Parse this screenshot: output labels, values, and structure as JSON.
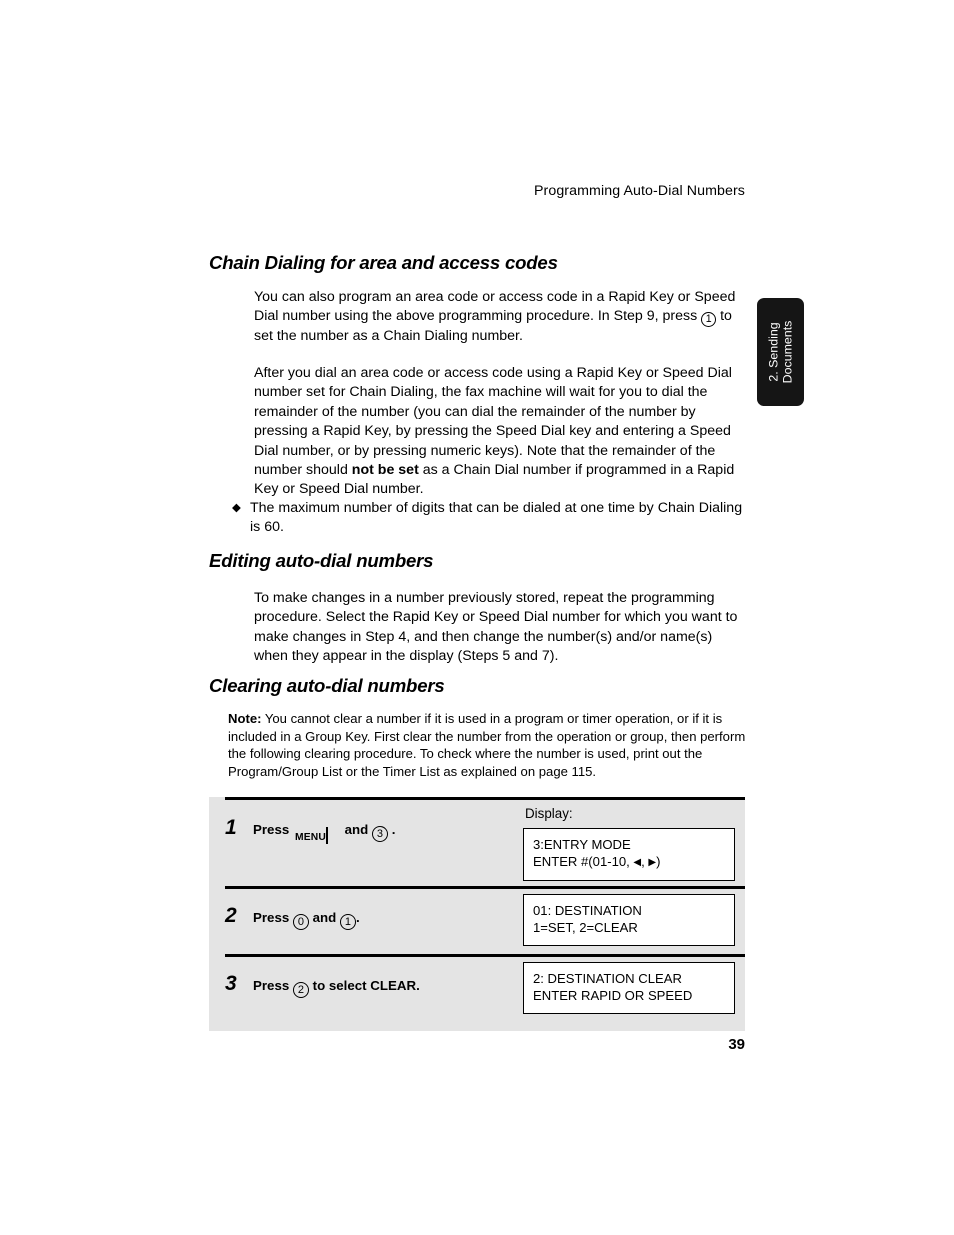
{
  "header": {
    "running_title": "Programming Auto-Dial Numbers"
  },
  "side_tab": {
    "line1": "2. Sending",
    "line2": "Documents",
    "bg_color": "#151515",
    "text_color": "#ffffff"
  },
  "sections": [
    {
      "heading": "Chain Dialing for area and access codes",
      "paragraphs": [
        {
          "pre": "You can also program an area code or access code in a Rapid Key or Speed Dial number using the above programming procedure. In Step 9, press ",
          "key": "1",
          "post": " to set the number as a Chain Dialing number."
        },
        {
          "pre": "After you dial an area code or access code using a Rapid Key or Speed Dial number set for Chain Dialing, the fax machine will wait for you to dial the remainder of the number (you can dial the remainder of the number by pressing a Rapid Key, by pressing the Speed Dial key and entering a Speed Dial number, or by pressing numeric keys). Note that the remainder of the number should ",
          "bold": "not be set",
          "post": " as a Chain Dial number if programmed in a Rapid Key or Speed Dial number."
        }
      ],
      "bullet": {
        "marker": "diamond-bullet",
        "text": "The maximum number of digits that can be dialed at one time by Chain Dialing is 60."
      }
    },
    {
      "heading": "Editing auto-dial numbers",
      "paragraph": "To make changes in a number previously stored, repeat the programming procedure. Select the Rapid Key or Speed Dial number for which you want to make changes in Step 4, and then change the number(s) and/or name(s) when they appear in the display (Steps 5 and 7)."
    },
    {
      "heading": "Clearing auto-dial numbers",
      "note_label": "Note:",
      "note_text": " You cannot clear a number if it is used in a program or timer operation, or if it is included in a Group Key. First clear the number from the operation or group, then perform the following clearing procedure. To check where the number is used, print out the Program/Group List or the Timer List as explained on page 115."
    }
  ],
  "steps_table": {
    "background_color": "#e4e4e4",
    "display_label": "Display:",
    "steps": [
      {
        "number": "1",
        "press_label": "Press",
        "menu_key_label": "MENU",
        "and_label": "and",
        "key": "3",
        "period": ".",
        "lcd_line1": "3:ENTRY MODE",
        "lcd_line2_pre": "ENTER #(01-10, ",
        "lcd_arrow_left": "◀",
        "lcd_line2_mid": ", ",
        "lcd_arrow_right": "▶",
        "lcd_line2_post": ")"
      },
      {
        "number": "2",
        "press_label": "Press",
        "key1": "0",
        "and_label": "and",
        "key2": "1",
        "period": ".",
        "lcd_line1": "01: DESTINATION",
        "lcd_line2": "1=SET, 2=CLEAR"
      },
      {
        "number": "3",
        "press_label": "Press",
        "key": "2",
        "suffix": "to select CLEAR.",
        "lcd_line1": "2: DESTINATION CLEAR",
        "lcd_line2": "ENTER RAPID OR SPEED"
      }
    ]
  },
  "folio": {
    "page_number": "39"
  }
}
